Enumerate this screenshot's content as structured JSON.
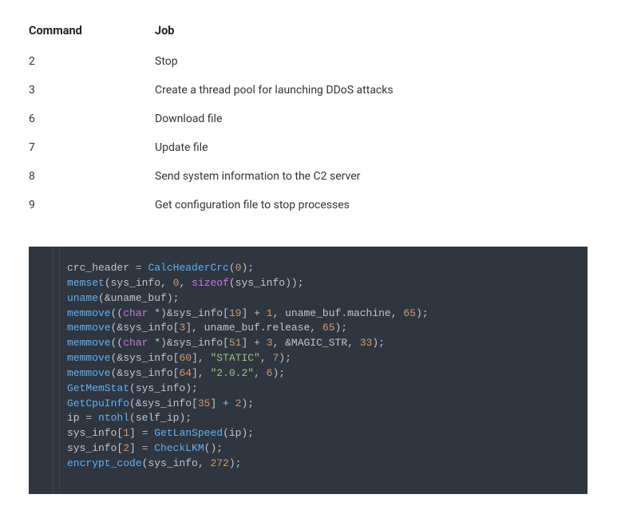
{
  "table": {
    "headers": {
      "command": "Command",
      "job": "Job"
    },
    "rows": [
      {
        "command": "2",
        "job": "Stop"
      },
      {
        "command": "3",
        "job": "Create a thread pool for launching DDoS attacks"
      },
      {
        "command": "6",
        "job": "Download file"
      },
      {
        "command": "7",
        "job": "Update file"
      },
      {
        "command": "8",
        "job": "Send system information to the C2 server"
      },
      {
        "command": "9",
        "job": "Get configuration file to stop processes"
      }
    ]
  },
  "code": {
    "lines": [
      [
        {
          "t": "crc_header ",
          "c": "c-default"
        },
        {
          "t": "= ",
          "c": "c-op"
        },
        {
          "t": "CalcHeaderCrc",
          "c": "c-func"
        },
        {
          "t": "(",
          "c": "c-default"
        },
        {
          "t": "0",
          "c": "c-num"
        },
        {
          "t": ");",
          "c": "c-default"
        }
      ],
      [
        {
          "t": "memset",
          "c": "c-func"
        },
        {
          "t": "(sys_info, ",
          "c": "c-default"
        },
        {
          "t": "0",
          "c": "c-num"
        },
        {
          "t": ", ",
          "c": "c-default"
        },
        {
          "t": "sizeof",
          "c": "c-keyword"
        },
        {
          "t": "(sys_info));",
          "c": "c-default"
        }
      ],
      [
        {
          "t": "uname",
          "c": "c-func"
        },
        {
          "t": "(&uname_buf);",
          "c": "c-default"
        }
      ],
      [
        {
          "t": "memmove",
          "c": "c-func"
        },
        {
          "t": "((",
          "c": "c-default"
        },
        {
          "t": "char",
          "c": "c-type"
        },
        {
          "t": " *)&sys_info[",
          "c": "c-default"
        },
        {
          "t": "19",
          "c": "c-num"
        },
        {
          "t": "] + ",
          "c": "c-default"
        },
        {
          "t": "1",
          "c": "c-num"
        },
        {
          "t": ", uname_buf.machine, ",
          "c": "c-default"
        },
        {
          "t": "65",
          "c": "c-num"
        },
        {
          "t": ");",
          "c": "c-default"
        }
      ],
      [
        {
          "t": "memmove",
          "c": "c-func"
        },
        {
          "t": "(&sys_info[",
          "c": "c-default"
        },
        {
          "t": "3",
          "c": "c-num"
        },
        {
          "t": "], uname_buf.release, ",
          "c": "c-default"
        },
        {
          "t": "65",
          "c": "c-num"
        },
        {
          "t": ");",
          "c": "c-default"
        }
      ],
      [
        {
          "t": "memmove",
          "c": "c-func"
        },
        {
          "t": "((",
          "c": "c-default"
        },
        {
          "t": "char",
          "c": "c-type"
        },
        {
          "t": " *)&sys_info[",
          "c": "c-default"
        },
        {
          "t": "51",
          "c": "c-num"
        },
        {
          "t": "] + ",
          "c": "c-default"
        },
        {
          "t": "3",
          "c": "c-num"
        },
        {
          "t": ", &MAGIC_STR, ",
          "c": "c-default"
        },
        {
          "t": "33",
          "c": "c-num"
        },
        {
          "t": ");",
          "c": "c-default"
        }
      ],
      [
        {
          "t": "memmove",
          "c": "c-func"
        },
        {
          "t": "(&sys_info[",
          "c": "c-default"
        },
        {
          "t": "60",
          "c": "c-num"
        },
        {
          "t": "], ",
          "c": "c-default"
        },
        {
          "t": "\"STATIC\"",
          "c": "c-str"
        },
        {
          "t": ", ",
          "c": "c-default"
        },
        {
          "t": "7",
          "c": "c-num"
        },
        {
          "t": ");",
          "c": "c-default"
        }
      ],
      [
        {
          "t": "memmove",
          "c": "c-func"
        },
        {
          "t": "(&sys_info[",
          "c": "c-default"
        },
        {
          "t": "64",
          "c": "c-num"
        },
        {
          "t": "], ",
          "c": "c-default"
        },
        {
          "t": "\"2.0.2\"",
          "c": "c-str"
        },
        {
          "t": ", ",
          "c": "c-default"
        },
        {
          "t": "6",
          "c": "c-num"
        },
        {
          "t": ");",
          "c": "c-default"
        }
      ],
      [
        {
          "t": "GetMemStat",
          "c": "c-func"
        },
        {
          "t": "(sys_info);",
          "c": "c-default"
        }
      ],
      [
        {
          "t": "GetCpuInfo",
          "c": "c-func"
        },
        {
          "t": "(&sys_info[",
          "c": "c-default"
        },
        {
          "t": "35",
          "c": "c-num"
        },
        {
          "t": "] + ",
          "c": "c-default"
        },
        {
          "t": "2",
          "c": "c-num"
        },
        {
          "t": ");",
          "c": "c-default"
        }
      ],
      [
        {
          "t": "ip ",
          "c": "c-default"
        },
        {
          "t": "= ",
          "c": "c-op"
        },
        {
          "t": "ntohl",
          "c": "c-func"
        },
        {
          "t": "(self_ip);",
          "c": "c-default"
        }
      ],
      [
        {
          "t": "sys_info[",
          "c": "c-default"
        },
        {
          "t": "1",
          "c": "c-num"
        },
        {
          "t": "] ",
          "c": "c-default"
        },
        {
          "t": "= ",
          "c": "c-op"
        },
        {
          "t": "GetLanSpeed",
          "c": "c-func"
        },
        {
          "t": "(ip);",
          "c": "c-default"
        }
      ],
      [
        {
          "t": "sys_info[",
          "c": "c-default"
        },
        {
          "t": "2",
          "c": "c-num"
        },
        {
          "t": "] ",
          "c": "c-default"
        },
        {
          "t": "= ",
          "c": "c-op"
        },
        {
          "t": "CheckLKM",
          "c": "c-func"
        },
        {
          "t": "();",
          "c": "c-default"
        }
      ],
      [
        {
          "t": "encrypt_code",
          "c": "c-func"
        },
        {
          "t": "(sys_info, ",
          "c": "c-default"
        },
        {
          "t": "272",
          "c": "c-num"
        },
        {
          "t": ");",
          "c": "c-default"
        }
      ]
    ]
  }
}
